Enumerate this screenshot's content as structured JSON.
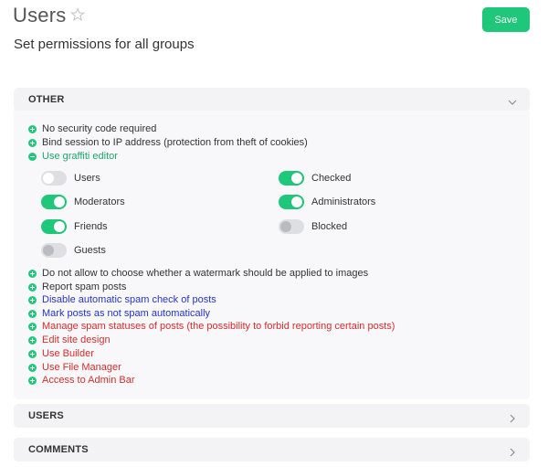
{
  "header": {
    "title": "Users",
    "subtitle": "Set permissions for all groups",
    "save_label": "Save"
  },
  "sections": {
    "other": {
      "label": "OTHER",
      "expanded": true
    },
    "users": {
      "label": "USERS",
      "expanded": false
    },
    "comments": {
      "label": "COMMENTS",
      "expanded": false
    }
  },
  "permissions_top": [
    {
      "label": "No security code required",
      "state": "plus",
      "color": "default"
    },
    {
      "label": "Bind session to IP address (protection from theft of cookies)",
      "state": "plus",
      "color": "default"
    },
    {
      "label": "Use graffiti editor",
      "state": "minus",
      "color": "green"
    }
  ],
  "groups": [
    {
      "label": "Users",
      "on": false
    },
    {
      "label": "Checked",
      "on": true
    },
    {
      "label": "Moderators",
      "on": true
    },
    {
      "label": "Administrators",
      "on": true
    },
    {
      "label": "Friends",
      "on": true
    },
    {
      "label": "Blocked",
      "on": false
    },
    {
      "label": "Guests",
      "on": false
    }
  ],
  "permissions_bottom": [
    {
      "label": "Do not allow to choose whether a watermark should be applied to images",
      "state": "plus",
      "color": "default"
    },
    {
      "label": "Report spam posts",
      "state": "plus",
      "color": "default"
    },
    {
      "label": "Disable automatic spam check of posts",
      "state": "plus",
      "color": "blue"
    },
    {
      "label": "Mark posts as not spam automatically",
      "state": "plus",
      "color": "blue"
    },
    {
      "label": "Manage spam statuses of posts (the possibility to forbid reporting certain posts)",
      "state": "plus",
      "color": "red"
    },
    {
      "label": "Edit site design",
      "state": "plus",
      "color": "red"
    },
    {
      "label": "Use Builder",
      "state": "plus",
      "color": "red"
    },
    {
      "label": "Use File Manager",
      "state": "plus",
      "color": "red"
    },
    {
      "label": "Access to Admin Bar",
      "state": "plus",
      "color": "red"
    }
  ],
  "colors": {
    "accent": "#1ec77a",
    "blue_text": "#2433c8",
    "red_text": "#d62c2c",
    "green_text": "#1ea56b"
  },
  "icons": {
    "star": "star-outline-icon",
    "expand": "chevron-down-icon",
    "collapse": "chevron-right-icon"
  }
}
